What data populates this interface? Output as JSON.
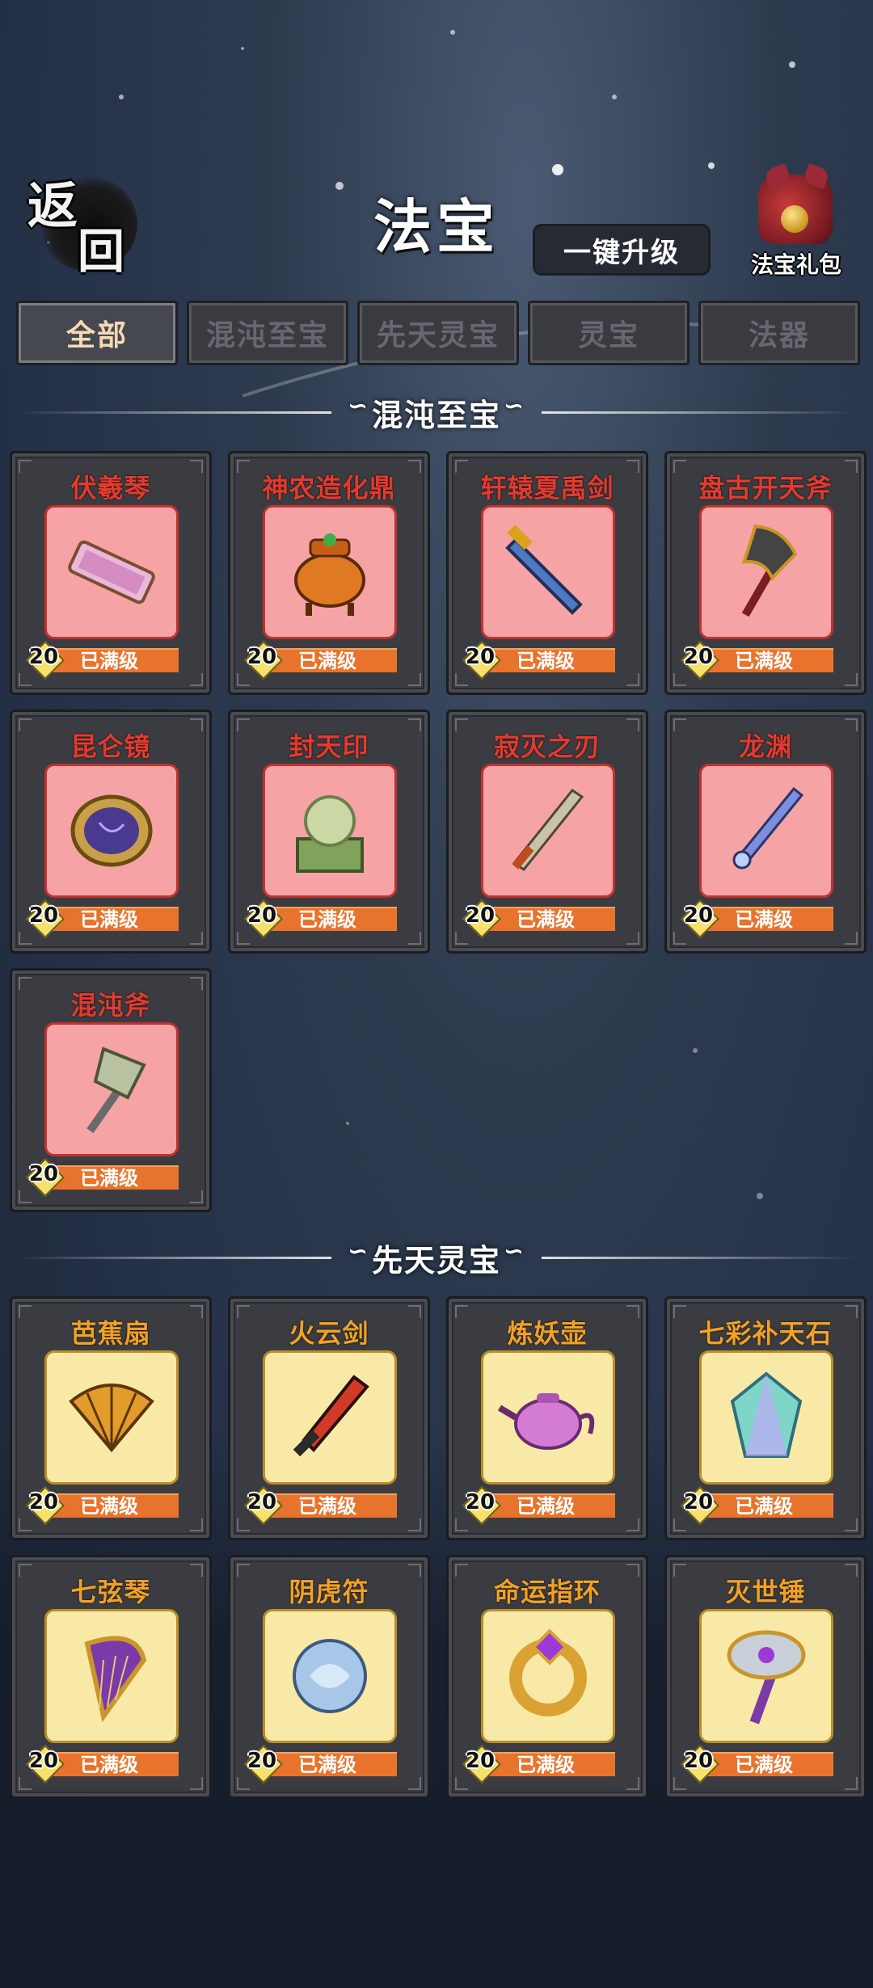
{
  "header": {
    "back_label_1": "返",
    "back_label_2": "回",
    "title": "法宝",
    "upgrade_label": "一键升级",
    "gift_label": "法宝礼包"
  },
  "tabs": [
    {
      "label": "全部",
      "active": true
    },
    {
      "label": "混沌至宝",
      "active": false
    },
    {
      "label": "先天灵宝",
      "active": false
    },
    {
      "label": "灵宝",
      "active": false
    },
    {
      "label": "法器",
      "active": false
    }
  ],
  "sections": [
    {
      "title": "混沌至宝",
      "items": [
        {
          "name": "伏羲琴",
          "level": "20",
          "status": "已满级",
          "icon": "qin-scroll-icon"
        },
        {
          "name": "神农造化鼎",
          "level": "20",
          "status": "已满级",
          "icon": "cauldron-icon"
        },
        {
          "name": "轩辕夏禹剑",
          "level": "20",
          "status": "已满级",
          "icon": "sword-icon"
        },
        {
          "name": "盘古开天斧",
          "level": "20",
          "status": "已满级",
          "icon": "axe-icon"
        },
        {
          "name": "昆仑镜",
          "level": "20",
          "status": "已满级",
          "icon": "mirror-icon"
        },
        {
          "name": "封天印",
          "level": "20",
          "status": "已满级",
          "icon": "jade-seal-icon"
        },
        {
          "name": "寂灭之刃",
          "level": "20",
          "status": "已满级",
          "icon": "blade-icon"
        },
        {
          "name": "龙渊",
          "level": "20",
          "status": "已满级",
          "icon": "dragon-sword-icon"
        },
        {
          "name": "混沌斧",
          "level": "20",
          "status": "已满级",
          "icon": "chaos-axe-icon"
        }
      ]
    },
    {
      "title": "先天灵宝",
      "items": [
        {
          "name": "芭蕉扇",
          "level": "20",
          "status": "已满级",
          "icon": "fan-icon"
        },
        {
          "name": "火云剑",
          "level": "20",
          "status": "已满级",
          "icon": "fire-sword-icon"
        },
        {
          "name": "炼妖壶",
          "level": "20",
          "status": "已满级",
          "icon": "teapot-icon"
        },
        {
          "name": "七彩补天石",
          "level": "20",
          "status": "已满级",
          "icon": "crystal-icon"
        },
        {
          "name": "七弦琴",
          "level": "20",
          "status": "已满级",
          "icon": "harp-icon"
        },
        {
          "name": "阴虎符",
          "level": "20",
          "status": "已满级",
          "icon": "tiger-tally-icon"
        },
        {
          "name": "命运指环",
          "level": "20",
          "status": "已满级",
          "icon": "ring-icon"
        },
        {
          "name": "灭世锤",
          "level": "20",
          "status": "已满级",
          "icon": "hammer-icon"
        }
      ]
    }
  ],
  "colors": {
    "red_name": "#e43a2e",
    "gold_name": "#f0a126",
    "pink_box": "#f6a3a6",
    "yellow_box": "#f8eaa6",
    "status_bar": "#e8732c"
  }
}
